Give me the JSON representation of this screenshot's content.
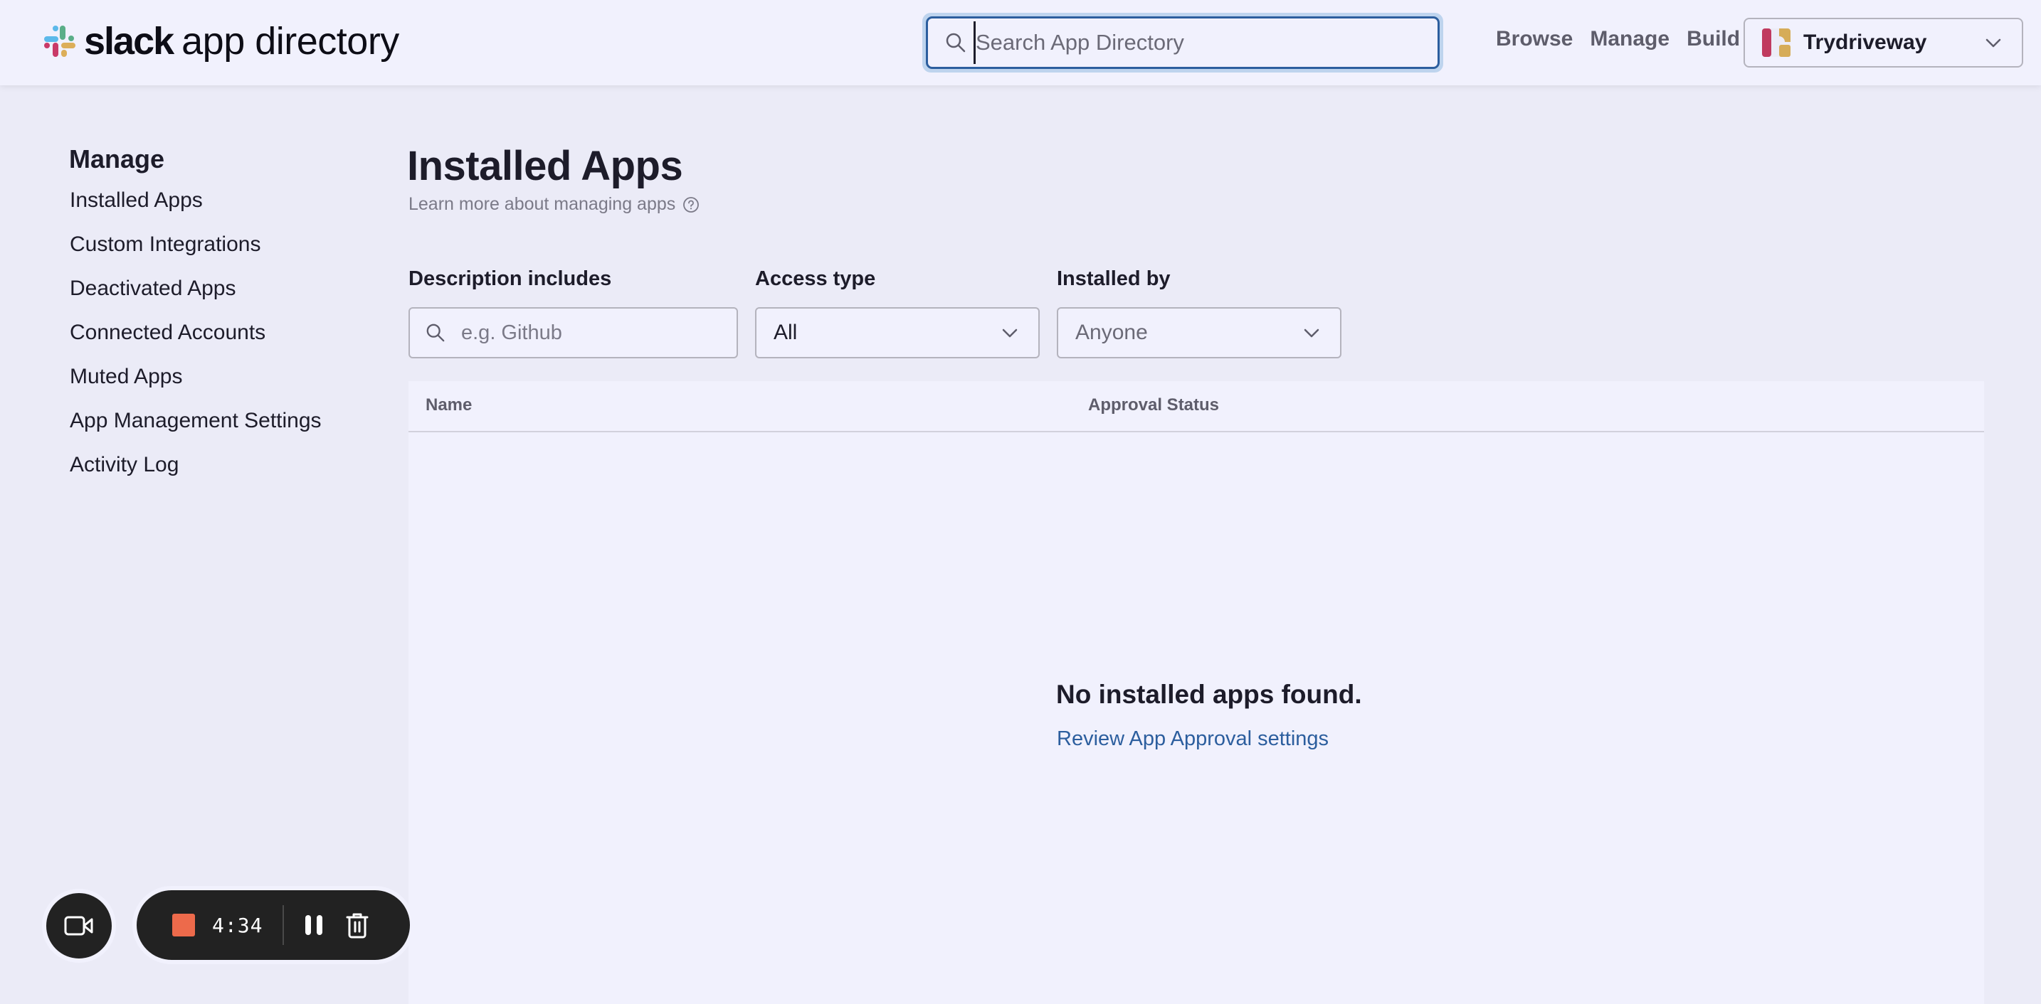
{
  "header": {
    "logo_bold": "slack",
    "logo_rest": "app directory",
    "search": {
      "placeholder": "Search App Directory",
      "value": ""
    },
    "nav": [
      "Browse",
      "Manage",
      "Build"
    ],
    "workspace": {
      "name": "Trydriveway",
      "icon": "workspace-logo"
    }
  },
  "sidebar": {
    "title": "Manage",
    "items": [
      "Installed Apps",
      "Custom Integrations",
      "Deactivated Apps",
      "Connected Accounts",
      "Muted Apps",
      "App Management Settings",
      "Activity Log"
    ]
  },
  "main": {
    "title": "Installed Apps",
    "subtitle": "Learn more about managing apps",
    "filters": {
      "description": {
        "label": "Description includes",
        "placeholder": "e.g. Github",
        "value": ""
      },
      "access_type": {
        "label": "Access type",
        "value": "All"
      },
      "installed_by": {
        "label": "Installed by",
        "value": "Anyone"
      }
    },
    "table": {
      "columns": [
        "Name",
        "Approval Status"
      ],
      "rows": [],
      "empty_message": "No installed apps found.",
      "empty_link": "Review App Approval settings"
    }
  },
  "recorder": {
    "elapsed": "4:34",
    "stop_color": "#ed6a4b",
    "icons": [
      "camera-icon",
      "stop-icon",
      "pause-icon",
      "trash-icon"
    ]
  },
  "colors": {
    "link": "#2c5e9e",
    "focus_ring": "#bed4ee",
    "page_bg": "#ebebf7",
    "surface": "#f1f1fd"
  }
}
